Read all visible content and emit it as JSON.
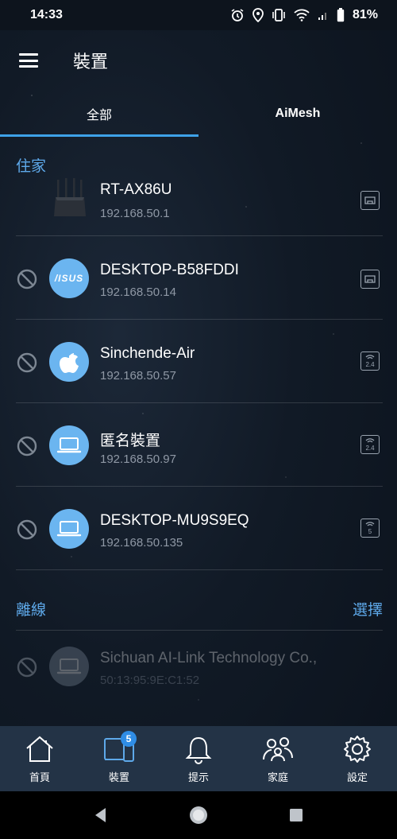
{
  "status_bar": {
    "time": "14:33",
    "battery": "81%"
  },
  "app_bar": {
    "title": "裝置"
  },
  "tabs": [
    {
      "label": "全部"
    },
    {
      "label": "AiMesh"
    }
  ],
  "home_section": {
    "label": "住家"
  },
  "devices": [
    {
      "name": "RT-AX86U",
      "ip": "192.168.50.1",
      "avatar": "router-icon",
      "connection": "ethernet-icon"
    },
    {
      "name": "DESKTOP-B58FDDI",
      "ip": "192.168.50.14",
      "avatar": "asus-logo",
      "avatar_text": "/ISUS",
      "connection": "ethernet-icon"
    },
    {
      "name": "Sinchende-Air",
      "ip": "192.168.50.57",
      "avatar": "apple-icon",
      "connection": "wifi-2.4-icon",
      "band": "2.4"
    },
    {
      "name": "匿名裝置",
      "ip": "192.168.50.97",
      "avatar": "laptop-icon",
      "connection": "wifi-2.4-icon",
      "band": "2.4"
    },
    {
      "name": "DESKTOP-MU9S9EQ",
      "ip": "192.168.50.135",
      "avatar": "laptop-icon",
      "connection": "wifi-5-icon",
      "band": "5"
    }
  ],
  "offline_section": {
    "label": "離線",
    "select_label": "選擇"
  },
  "offline_devices": [
    {
      "name": "Sichuan AI-Link Technology Co.,",
      "ip": "50:13:95:9E:C1:52",
      "avatar": "laptop-icon"
    }
  ],
  "bottom_nav": {
    "items": [
      {
        "label": "首頁",
        "icon": "home-icon"
      },
      {
        "label": "裝置",
        "icon": "devices-icon",
        "badge": "5"
      },
      {
        "label": "提示",
        "icon": "bell-icon"
      },
      {
        "label": "家庭",
        "icon": "family-icon"
      },
      {
        "label": "設定",
        "icon": "gear-icon"
      }
    ]
  },
  "colors": {
    "accent": "#3ea2e8",
    "section_label": "#5ea9ea",
    "avatar_bg": "#6bb5f0",
    "nav_bg": "#233346"
  }
}
